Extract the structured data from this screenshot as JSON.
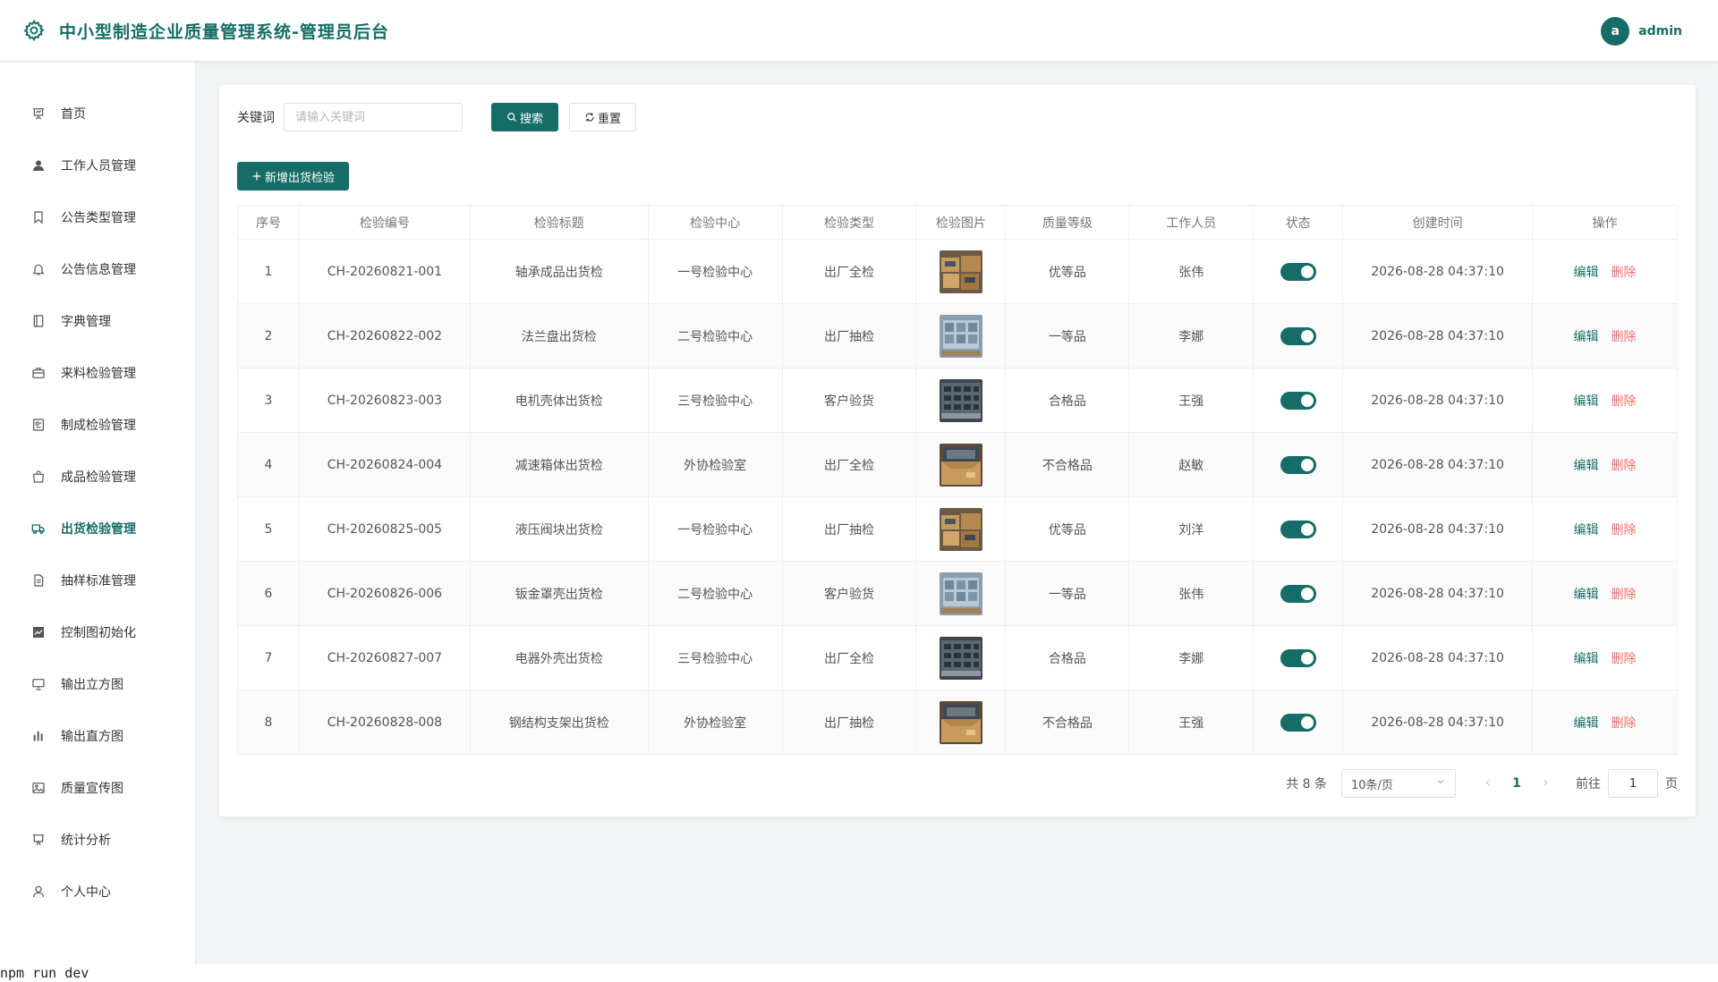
{
  "app": {
    "title": "中小型制造企业质量管理系统-管理员后台",
    "user_avatar": "a",
    "user_name": "admin"
  },
  "sidebar": {
    "items": [
      {
        "label": "首页",
        "icon": "presentation-icon"
      },
      {
        "label": "工作人员管理",
        "icon": "user-icon"
      },
      {
        "label": "公告类型管理",
        "icon": "bookmark-icon"
      },
      {
        "label": "公告信息管理",
        "icon": "bell-icon"
      },
      {
        "label": "字典管理",
        "icon": "notebook-icon"
      },
      {
        "label": "来料检验管理",
        "icon": "briefcase-icon"
      },
      {
        "label": "制成检验管理",
        "icon": "reading-icon"
      },
      {
        "label": "成品检验管理",
        "icon": "bag-icon"
      },
      {
        "label": "出货检验管理",
        "icon": "truck-icon"
      },
      {
        "label": "抽样标准管理",
        "icon": "document-icon"
      },
      {
        "label": "控制图初始化",
        "icon": "chart-icon"
      },
      {
        "label": "输出立方图",
        "icon": "monitor-icon"
      },
      {
        "label": "输出直方图",
        "icon": "histogram-icon"
      },
      {
        "label": "质量宣传图",
        "icon": "picture-icon"
      },
      {
        "label": "统计分析",
        "icon": "data-board-icon"
      },
      {
        "label": "个人中心",
        "icon": "user-outline-icon"
      }
    ],
    "active_index": 8
  },
  "search": {
    "label": "关键词",
    "placeholder": "请输入关键词",
    "value": "",
    "search_button": "搜索",
    "reset_button": "重置"
  },
  "toolbar": {
    "add_button": "新增出货检验"
  },
  "table": {
    "columns": [
      "序号",
      "检验编号",
      "检验标题",
      "检验中心",
      "检验类型",
      "检验图片",
      "质量等级",
      "工作人员",
      "状态",
      "创建时间",
      "操作"
    ],
    "edit_label": "编辑",
    "delete_label": "删除",
    "rows": [
      {
        "no": "1",
        "code": "CH-20260821-001",
        "title": "轴承成品出货检",
        "center": "一号检验中心",
        "type": "出厂全检",
        "image": "boxes-photo",
        "grade": "优等品",
        "staff": "张伟",
        "status": true,
        "created": "2026-08-28 04:37:10"
      },
      {
        "no": "2",
        "code": "CH-20260822-002",
        "title": "法兰盘出货检",
        "center": "二号检验中心",
        "type": "出厂抽检",
        "image": "pallet-photo",
        "grade": "一等品",
        "staff": "李娜",
        "status": true,
        "created": "2026-08-28 04:37:10"
      },
      {
        "no": "3",
        "code": "CH-20260823-003",
        "title": "电机壳体出货检",
        "center": "三号检验中心",
        "type": "客户验货",
        "image": "crate-photo",
        "grade": "合格品",
        "staff": "王强",
        "status": true,
        "created": "2026-08-28 04:37:10"
      },
      {
        "no": "4",
        "code": "CH-20260824-004",
        "title": "减速箱体出货检",
        "center": "外协检验室",
        "type": "出厂全检",
        "image": "carton-photo",
        "grade": "不合格品",
        "staff": "赵敏",
        "status": true,
        "created": "2026-08-28 04:37:10"
      },
      {
        "no": "5",
        "code": "CH-20260825-005",
        "title": "液压阀块出货检",
        "center": "一号检验中心",
        "type": "出厂抽检",
        "image": "boxes-photo",
        "grade": "优等品",
        "staff": "刘洋",
        "status": true,
        "created": "2026-08-28 04:37:10"
      },
      {
        "no": "6",
        "code": "CH-20260826-006",
        "title": "钣金罩壳出货检",
        "center": "二号检验中心",
        "type": "客户验货",
        "image": "pallet-photo",
        "grade": "一等品",
        "staff": "张伟",
        "status": true,
        "created": "2026-08-28 04:37:10"
      },
      {
        "no": "7",
        "code": "CH-20260827-007",
        "title": "电器外壳出货检",
        "center": "三号检验中心",
        "type": "出厂全检",
        "image": "crate-photo",
        "grade": "合格品",
        "staff": "李娜",
        "status": true,
        "created": "2026-08-28 04:37:10"
      },
      {
        "no": "8",
        "code": "CH-20260828-008",
        "title": "钢结构支架出货检",
        "center": "外协检验室",
        "type": "出厂抽检",
        "image": "carton-photo",
        "grade": "不合格品",
        "staff": "王强",
        "status": true,
        "created": "2026-08-28 04:37:10"
      }
    ]
  },
  "pagination": {
    "total_text": "共 8 条",
    "page_size": "10条/页",
    "current_page": "1",
    "goto_label": "前往",
    "goto_value": "1",
    "page_word": "页"
  },
  "terminal": {
    "text": "npm run dev"
  },
  "colors": {
    "primary": "#166d67",
    "danger": "#f56c6c",
    "background": "#f1f4f4"
  }
}
